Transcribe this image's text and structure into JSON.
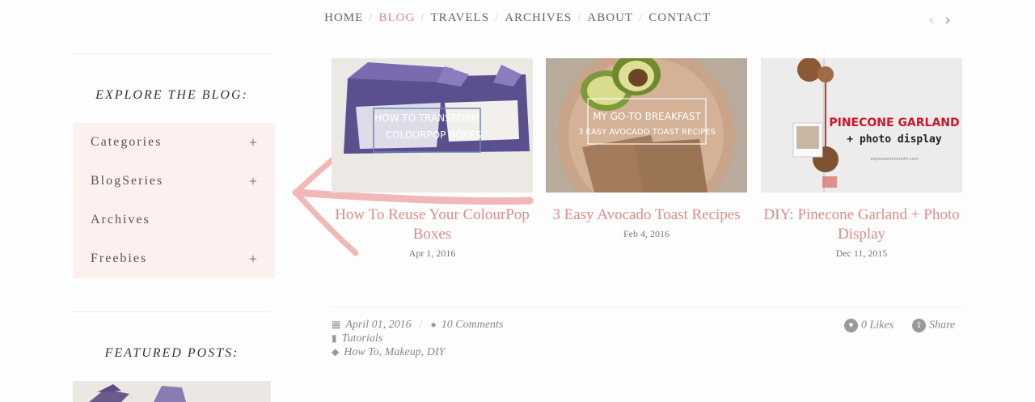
{
  "nav": {
    "items": [
      "HOME",
      "BLOG",
      "TRAVELS",
      "ARCHIVES",
      "ABOUT",
      "CONTACT"
    ],
    "separator": "/",
    "active_color": "#d98c8c",
    "prev_icon": "‹",
    "next_icon": "›"
  },
  "sidebar": {
    "explore_title": "EXPLORE THE BLOG:",
    "items": [
      {
        "label": "Categories",
        "expand": "+"
      },
      {
        "label": "BlogSeries",
        "expand": "+"
      },
      {
        "label": "Archives",
        "expand": ""
      },
      {
        "label": "Freebies",
        "expand": "+"
      }
    ],
    "featured_title": "FEATURED POSTS:"
  },
  "posts": [
    {
      "thumb_text": "HOW TO TRANSFORM COLOURPOP BOXES",
      "title": "How To Reuse Your ColourPop Boxes",
      "date": "Apr 1, 2016"
    },
    {
      "thumb_text_1": "MY GO-TO BREAKFAST",
      "thumb_text_2": "3 EASY AVOCADO TOAST RECIPES",
      "title": "3 Easy Avocado Toast Recipes",
      "date": "Feb 4, 2016"
    },
    {
      "thumb_text_1": "PINECONE GARLAND",
      "thumb_text_2": "+ photo display",
      "thumb_url": "explorewithcarinth.com",
      "title": "DIY: Pinecone Garland + Photo Display",
      "date": "Dec 11, 2015"
    }
  ],
  "meta": {
    "date": "April 01, 2016",
    "comments": "10 Comments",
    "category": "Tutorials",
    "tags": "How To, Makeup, DIY",
    "likes": "0 Likes",
    "share": "Share"
  },
  "colors": {
    "accent": "#d98c8c",
    "sidebar_bg": "#fdf1ef",
    "annotation": "#f2b8b8"
  }
}
